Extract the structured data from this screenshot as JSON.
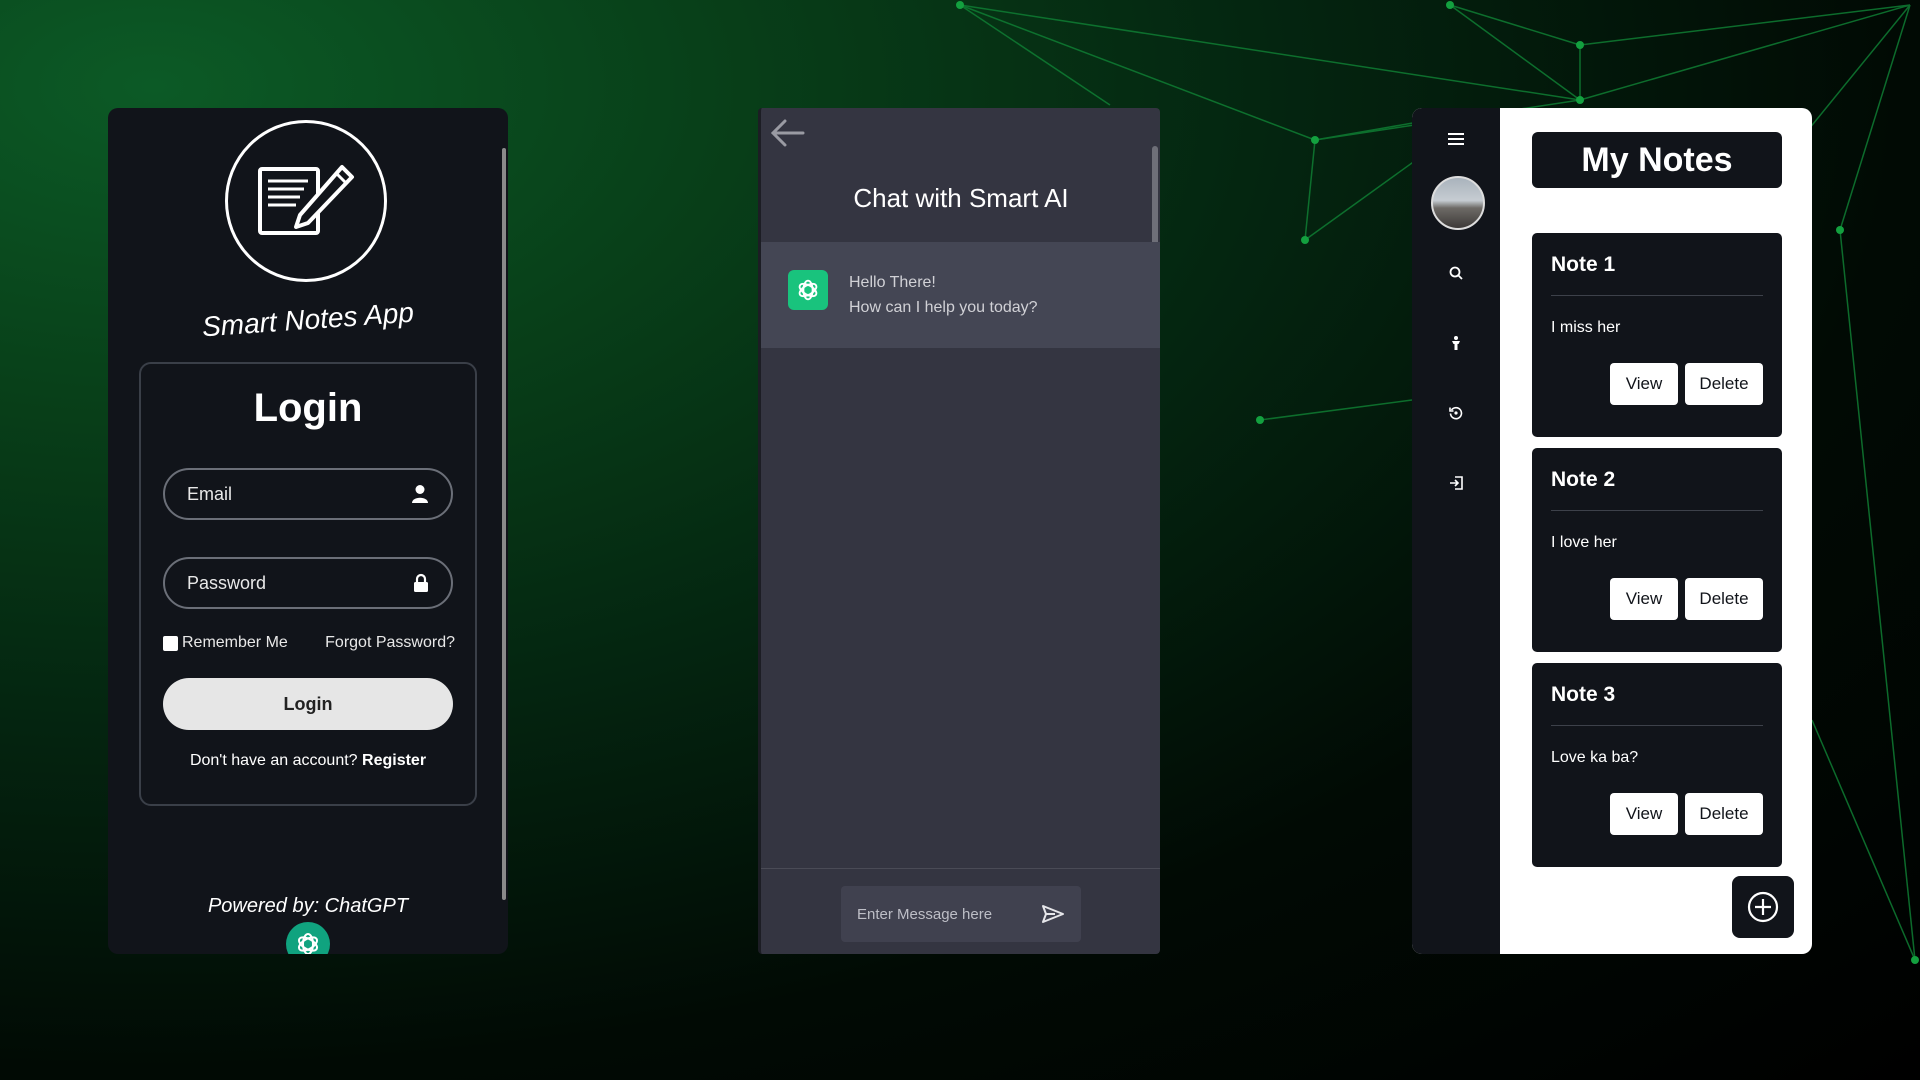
{
  "login_screen": {
    "app_title": "Smart Notes App",
    "heading": "Login",
    "email_placeholder": "Email",
    "password_placeholder": "Password",
    "remember_label": "Remember Me",
    "forgot_label": "Forgot Password?",
    "login_button": "Login",
    "register_prompt": "Don't have an account?",
    "register_link": "Register",
    "powered_by": "Powered by: ChatGPT",
    "icons": [
      "notepad-pencil-icon",
      "user-icon",
      "lock-icon",
      "openai-logo-icon"
    ]
  },
  "chat_screen": {
    "title": "Chat with Smart AI",
    "messages": [
      {
        "sender": "bot",
        "line1": "Hello There!",
        "line2": "How can I help you today?"
      }
    ],
    "input_placeholder": "Enter Message here",
    "icons": [
      "back-arrow-icon",
      "openai-logo-icon",
      "send-icon"
    ]
  },
  "notes_screen": {
    "title": "My Notes",
    "sidebar_icons": [
      "menu-icon",
      "avatar",
      "search-icon",
      "person-icon",
      "history-icon",
      "logout-icon"
    ],
    "notes": [
      {
        "title": "Note 1",
        "body": "I miss her",
        "view_label": "View",
        "delete_label": "Delete"
      },
      {
        "title": "Note 2",
        "body": "I love her",
        "view_label": "View",
        "delete_label": "Delete"
      },
      {
        "title": "Note 3",
        "body": "Love ka ba?",
        "view_label": "View",
        "delete_label": "Delete"
      }
    ],
    "fab_icon": "add-circle-icon"
  },
  "colors": {
    "panel_dark": "#11141a",
    "chat_bg": "#343541",
    "chat_bubble": "#444654",
    "openai_green": "#10a37f",
    "accent_green": "#0a7a30"
  }
}
